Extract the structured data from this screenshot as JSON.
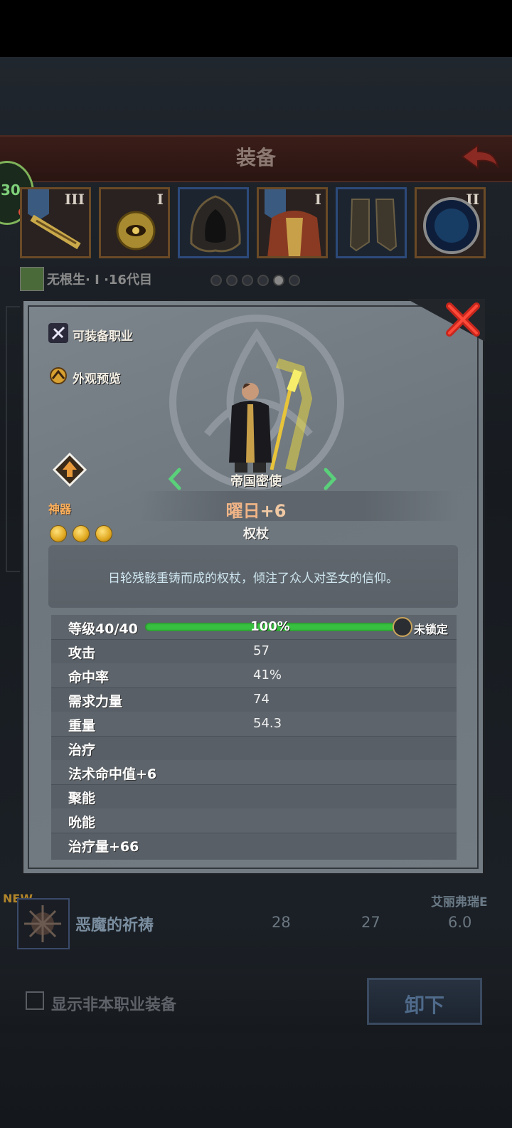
{
  "header": {
    "title": "装备",
    "back_label": ""
  },
  "side_badge": {
    "label": "30"
  },
  "slots": [
    {
      "rank": "III",
      "frame": "orange",
      "crest": true
    },
    {
      "rank": "I",
      "frame": "orange",
      "crest": false
    },
    {
      "rank": "",
      "frame": "blue",
      "crest": false
    },
    {
      "rank": "I",
      "frame": "orange",
      "crest": true
    },
    {
      "rank": "",
      "frame": "blue",
      "crest": false
    },
    {
      "rank": "II",
      "frame": "orange",
      "crest": false
    }
  ],
  "hero": {
    "name": "无根生· I ·16代目"
  },
  "page_dots": {
    "count": 6,
    "active": 4
  },
  "popup": {
    "options": {
      "class_label": "可装备职业",
      "preview_label": "外观预览"
    },
    "artifact_label": "神器",
    "gem_count": 3,
    "codename": "帝国密使",
    "weapon_name": "曜日",
    "weapon_plus": "+6",
    "weapon_type": "权杖",
    "description": "日轮残骸重铸而成的权杖，倾注了众人对圣女的信仰。",
    "level": {
      "label": "等级40/40",
      "percent_text": "100%",
      "fill": 1.0,
      "lock_text": "未锁定"
    },
    "stats": [
      {
        "key": "攻击",
        "value": "57"
      },
      {
        "key": "命中率",
        "value": "41%"
      },
      {
        "key": "需求力量",
        "value": "74"
      },
      {
        "key": "重量",
        "value": "54.3"
      },
      {
        "key": "治疗",
        "value": ""
      },
      {
        "key": "法术命中值+6",
        "value": ""
      },
      {
        "key": "聚能",
        "value": ""
      },
      {
        "key": "吮能",
        "value": ""
      },
      {
        "key": "治疗量+66",
        "value": ""
      }
    ]
  },
  "bg_list": {
    "new_label": "NEW",
    "item_name": "恶魔的祈祷",
    "v1": "28",
    "v2": "27",
    "v3": "6.0",
    "owner": "艾丽弗瑞E"
  },
  "bottom": {
    "checkbox_label": "显示非本职业装备",
    "unequip_label": "卸下"
  },
  "colors": {
    "accent": "#f0b486",
    "bar": "#38c040",
    "artifact": "#ffb05a"
  }
}
